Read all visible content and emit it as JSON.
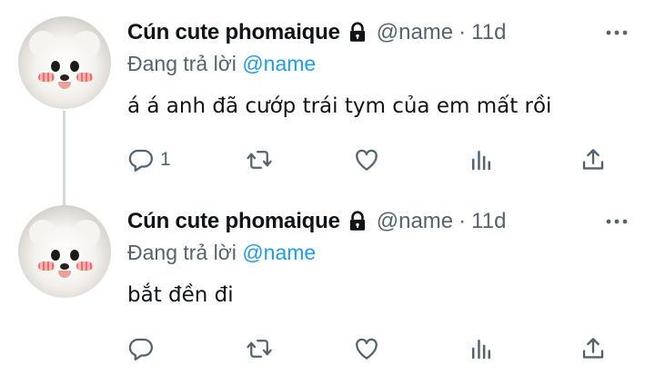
{
  "tweets": [
    {
      "display_name": "Cún cute phomaique",
      "handle": "@name",
      "separator": "·",
      "time": "11d",
      "reply_prefix": "Đang trả lời",
      "reply_mention": "@name",
      "text": "á á anh đã cướp trái tym của em mất rồi",
      "reply_count": "1",
      "icons": [
        "lock-icon",
        "more-icon",
        "reply-icon",
        "retweet-icon",
        "like-icon",
        "views-icon",
        "share-icon"
      ]
    },
    {
      "display_name": "Cún cute phomaique",
      "handle": "@name",
      "separator": "·",
      "time": "11d",
      "reply_prefix": "Đang trả lời",
      "reply_mention": "@name",
      "text": "bắt đền đi",
      "reply_count": "",
      "icons": [
        "lock-icon",
        "more-icon",
        "reply-icon",
        "retweet-icon",
        "like-icon",
        "views-icon",
        "share-icon"
      ]
    }
  ],
  "colors": {
    "text": "#0f1419",
    "secondary": "#536471",
    "accent": "#1d9bf0",
    "thread_line": "#cfd9de"
  }
}
